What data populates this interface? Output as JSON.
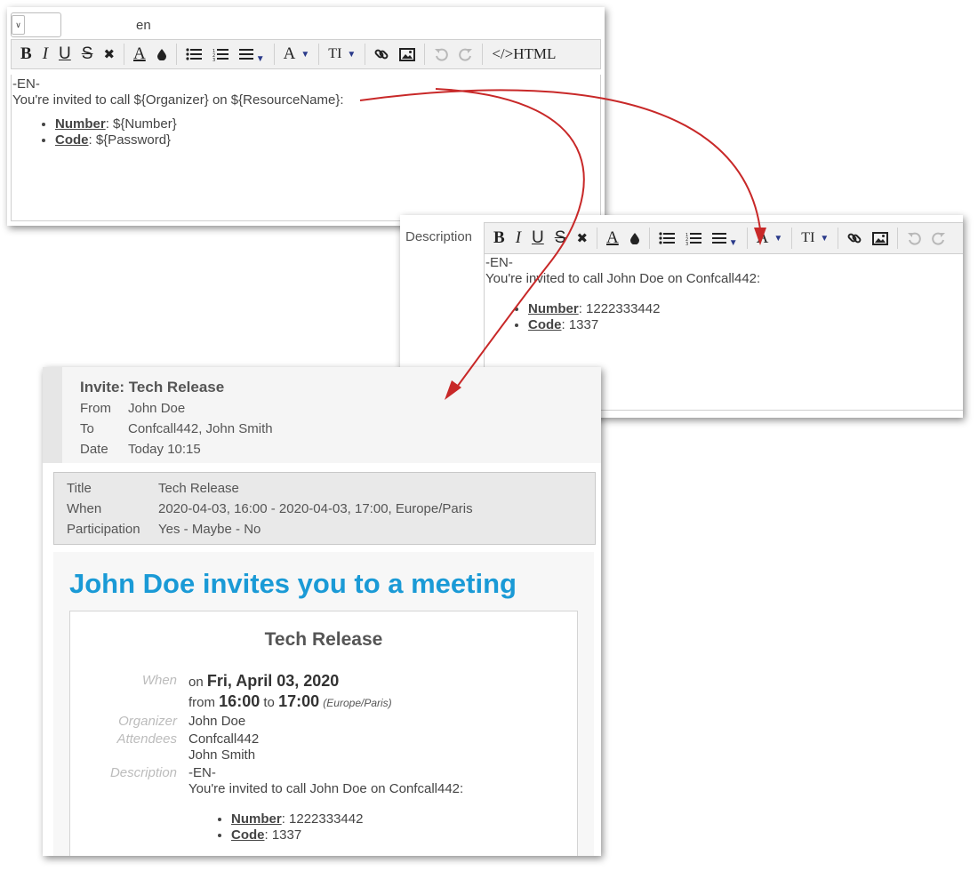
{
  "editor_top": {
    "language": "en",
    "toolbar": {
      "bold": "B",
      "italic": "I",
      "underline": "U",
      "strike": "S",
      "clear": "✖",
      "font_color": "A",
      "highlight": "💧",
      "fontname": "A",
      "fontsize": "TI",
      "html": "</>HTML"
    },
    "content": {
      "line1": "-EN-",
      "line2": "You're invited to call ${Organizer} on ${ResourceName}:",
      "items": [
        {
          "label": "Number",
          "value": ": ${Number}"
        },
        {
          "label": "Code",
          "value": ": ${Password}"
        }
      ]
    }
  },
  "editor_bottom": {
    "field_label": "Description",
    "toolbar": {
      "bold": "B",
      "italic": "I",
      "underline": "U",
      "strike": "S",
      "clear": "✖",
      "font_color": "A",
      "highlight": "💧",
      "fontname": "A",
      "fontsize": "TI"
    },
    "content": {
      "line1": "-EN-",
      "line2": "You're invited to call John Doe on Confcall442:",
      "items": [
        {
          "label": "Number",
          "value": ": 1222333442"
        },
        {
          "label": "Code",
          "value": ": 1337"
        }
      ]
    }
  },
  "email": {
    "subject": "Invite: Tech Release",
    "from_label": "From",
    "from": "John Doe",
    "to_label": "To",
    "to": "Confcall442, John Smith",
    "date_label": "Date",
    "date": "Today 10:15",
    "summary": {
      "title_label": "Title",
      "title": "Tech Release",
      "when_label": "When",
      "when": "2020-04-03, 16:00 - 2020-04-03, 17:00, Europe/Paris",
      "participation_label": "Participation",
      "participation": {
        "yes": "Yes",
        "maybe": "Maybe",
        "no": "No",
        "sep": " - "
      }
    },
    "invite_heading": "John Doe invites you to a meeting",
    "card": {
      "title": "Tech Release",
      "when_label": "When",
      "on": "on",
      "date": "Fri, April 03, 2020",
      "from": "from",
      "start": "16:00",
      "to": "to",
      "end": "17:00",
      "tz": "(Europe/Paris)",
      "organizer_label": "Organizer",
      "organizer": "John Doe",
      "attendees_label": "Attendees",
      "attendees": [
        "Confcall442",
        "John Smith"
      ],
      "description_label": "Description",
      "desc_line1": "-EN-",
      "desc_line2": "You're invited to call John Doe on Confcall442:",
      "items": [
        {
          "label": "Number",
          "value": ": 1222333442"
        },
        {
          "label": "Code",
          "value": ": 1337"
        }
      ]
    }
  },
  "colors": {
    "arrow": "#c82828",
    "heading": "#1a9ad6"
  }
}
